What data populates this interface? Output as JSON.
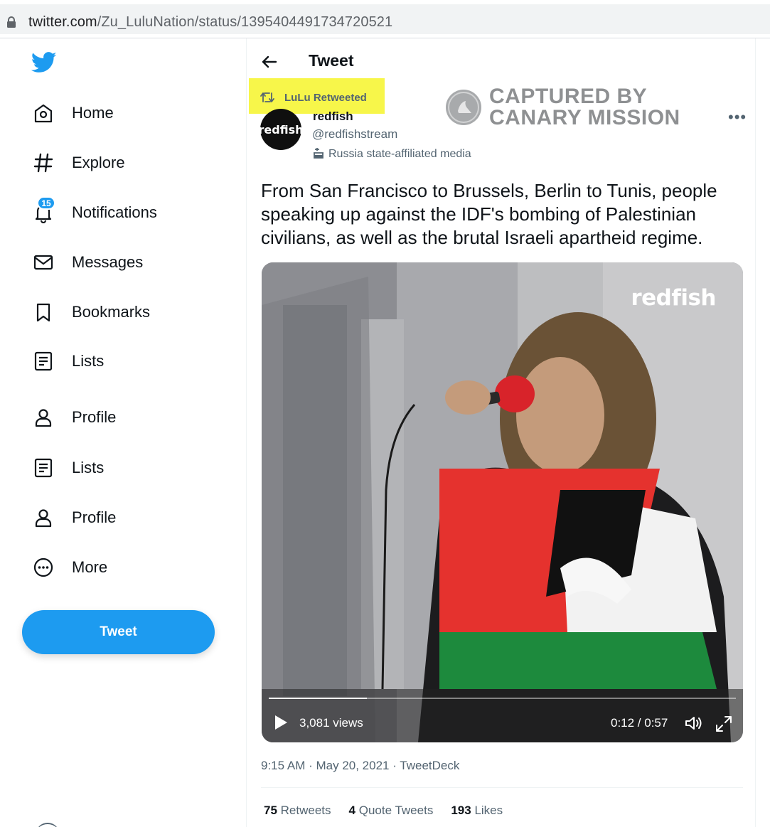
{
  "browser": {
    "url_host": "twitter.com",
    "url_path": "/Zu_LuluNation/status/1395404491734720521"
  },
  "sidebar": {
    "items": [
      {
        "label": "Home",
        "icon": "home-icon"
      },
      {
        "label": "Explore",
        "icon": "hashtag-icon"
      },
      {
        "label": "Notifications",
        "icon": "bell-icon",
        "badge": "15"
      },
      {
        "label": "Messages",
        "icon": "envelope-icon"
      },
      {
        "label": "Bookmarks",
        "icon": "bookmark-icon"
      },
      {
        "label": "Lists",
        "icon": "list-icon"
      },
      {
        "label": "Profile",
        "icon": "person-icon"
      },
      {
        "label": "Lists",
        "icon": "list-icon"
      },
      {
        "label": "Profile",
        "icon": "person-icon"
      },
      {
        "label": "More",
        "icon": "more-circle-icon"
      }
    ],
    "tweet_button": "Tweet"
  },
  "header": {
    "title": "Tweet"
  },
  "retweet_context": "LuLu Retweeted",
  "watermark": {
    "line1": "CAPTURED BY",
    "line2": "CANARY MISSION"
  },
  "author": {
    "avatar_text": "redfish",
    "name": "redfish",
    "handle": "@redfishstream",
    "affiliation": "Russia state-affiliated media"
  },
  "tweet": {
    "text": "From San Francisco to Brussels, Berlin to Tunis, people speaking up against the IDF's bombing of Palestinian civilians, as well as the brutal Israeli apartheid regime.",
    "meta": "9:15 AM · May 20, 2021 · TweetDeck"
  },
  "video": {
    "logo": "redfish",
    "views": "3,081 views",
    "timecode": "0:12 / 0:57",
    "progress": 0.21
  },
  "stats": {
    "retweets_count": "75",
    "retweets_label": "Retweets",
    "quotes_count": "4",
    "quotes_label": "Quote Tweets",
    "likes_count": "193",
    "likes_label": "Likes"
  },
  "colors": {
    "accent": "#1d9bf0",
    "highlight": "#f7f64a"
  }
}
